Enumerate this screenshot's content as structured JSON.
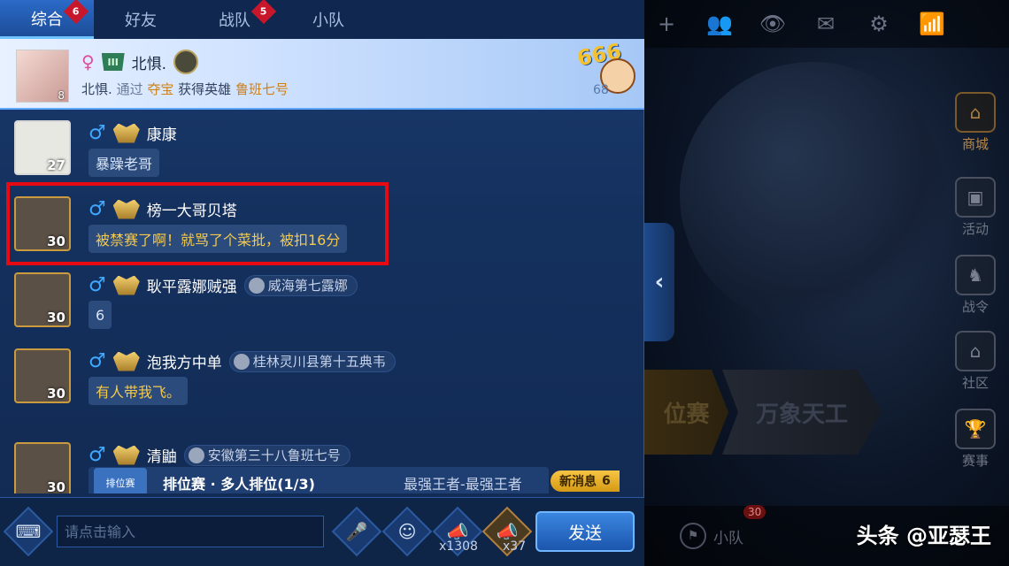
{
  "tabs": [
    {
      "label": "综合",
      "badge": "6"
    },
    {
      "label": "好友",
      "badge": ""
    },
    {
      "label": "战队",
      "badge": "5"
    },
    {
      "label": "小队",
      "badge": ""
    }
  ],
  "system_message": {
    "name": "北惧.",
    "level": "8",
    "rank_icon": "III",
    "line_prefix": "北惧.",
    "text_1": "通过",
    "source": "夺宝",
    "text_2": "获得英雄",
    "hero": "鲁班七号",
    "sticker_text": "666",
    "sticker_count": "68"
  },
  "messages": [
    {
      "name": "康康",
      "level": "27",
      "title": "",
      "text": "暴躁老哥",
      "text_color": "normal"
    },
    {
      "name": "榜一大哥贝塔",
      "level": "30",
      "title": "",
      "text": "被禁赛了啊！就骂了个菜批，被扣16分",
      "text_color": "yellow"
    },
    {
      "name": "耿平露娜贼强",
      "level": "30",
      "title": "威海第七露娜",
      "text": "6",
      "text_color": "normal"
    },
    {
      "name": "泡我方中单",
      "level": "30",
      "title": "桂林灵川县第十五典韦",
      "text": "有人带我飞。",
      "text_color": "yellow"
    },
    {
      "name": "清鼬",
      "level": "30",
      "title": "安徽第三十八鲁班七号",
      "text": "",
      "text_color": "normal"
    }
  ],
  "card": {
    "icon_label": "排位赛",
    "title": "排位赛 · 多人排位(1/3)",
    "rank": "最强王者-最强王者"
  },
  "new_messages": {
    "label": "新消息",
    "count": "6"
  },
  "input": {
    "placeholder": "请点击输入",
    "send_label": "发送",
    "horn_count": "x1308",
    "gold_horn_count": "x37"
  },
  "game": {
    "side_menu": [
      "商城",
      "活动",
      "战令",
      "社区",
      "赛事"
    ],
    "mode_1": "位赛",
    "mode_2": "万象天工",
    "squad_label": "小队",
    "squad_badge": "30"
  },
  "watermark": "头条 @亚瑟王"
}
